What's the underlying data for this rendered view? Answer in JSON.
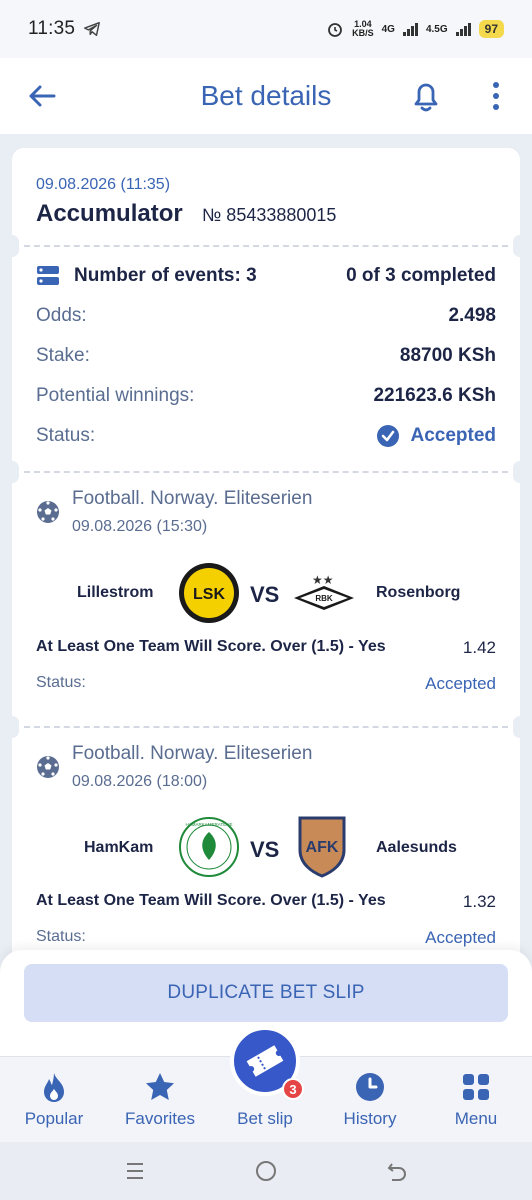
{
  "status_bar": {
    "time": "11:35",
    "net_speed_value": "1.04",
    "net_speed_unit": "KB/S",
    "net_type_1": "4G",
    "net_type_2": "4.5G",
    "battery": "97"
  },
  "header": {
    "title": "Bet details",
    "back_icon": "arrow-left-icon",
    "bell_icon": "bell-icon",
    "menu_icon": "kebab-menu-icon"
  },
  "bet": {
    "date": "09.08.2026 (11:35)",
    "type": "Accumulator",
    "number": "№ 85433880015",
    "events_label": "Number of events: 3",
    "events_progress": "0 of 3 completed",
    "odds_label": "Odds:",
    "odds_value": "2.498",
    "stake_label": "Stake:",
    "stake_value": "88700 KSh",
    "winnings_label": "Potential winnings:",
    "winnings_value": "221623.6 KSh",
    "status_label": "Status:",
    "status_value": "Accepted"
  },
  "events": [
    {
      "league": "Football. Norway. Eliteserien",
      "date": "09.08.2026 (15:30)",
      "home": "Lillestrom",
      "vs": "VS",
      "away": "Rosenborg",
      "home_logo_text": "LSK",
      "away_logo_text": "RBK",
      "market": "At Least One Team Will Score. Over (1.5) - Yes",
      "coef": "1.42",
      "status_label": "Status:",
      "status_value": "Accepted"
    },
    {
      "league": "Football. Norway. Eliteserien",
      "date": "09.08.2026 (18:00)",
      "home": "HamKam",
      "vs": "VS",
      "away": "Aalesunds",
      "home_logo_text": "HAMARKAMERATENE",
      "away_logo_text": "AFK",
      "market": "At Least One Team Will Score. Over (1.5) - Yes",
      "coef": "1.32",
      "status_label": "Status:",
      "status_value": "Accepted"
    }
  ],
  "duplicate_button": "DUPLICATE BET SLIP",
  "tabs": [
    {
      "label": "Popular",
      "icon": "flame-icon"
    },
    {
      "label": "Favorites",
      "icon": "star-icon"
    },
    {
      "label": "Bet slip",
      "icon": "ticket-icon",
      "badge": "3"
    },
    {
      "label": "History",
      "icon": "clock-icon"
    },
    {
      "label": "Menu",
      "icon": "grid-icon"
    }
  ],
  "colors": {
    "accent": "#3a64b4",
    "fab": "#3758c8",
    "badge": "#e54545",
    "background": "#e9edf4"
  }
}
